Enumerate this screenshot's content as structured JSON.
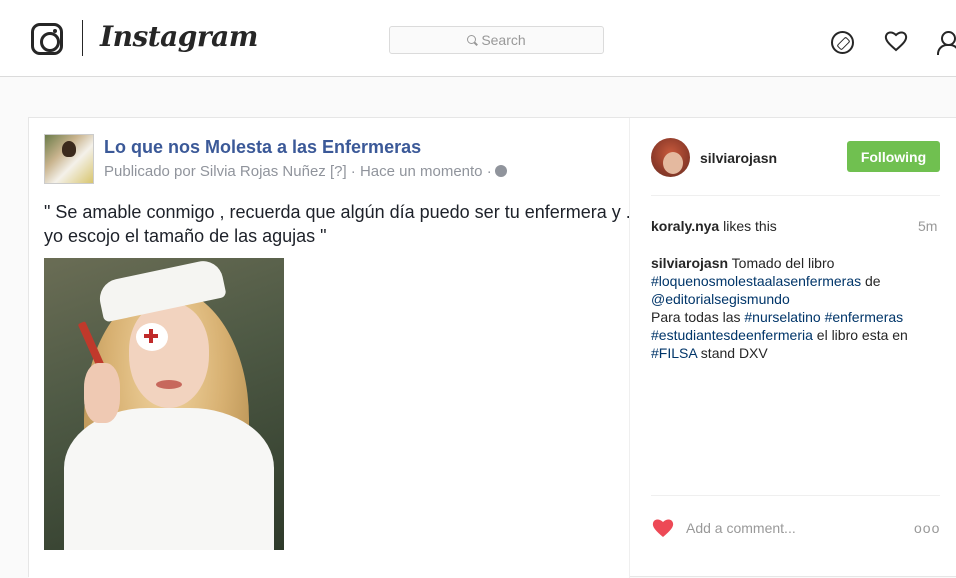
{
  "header": {
    "wordmark": "Instagram",
    "search_placeholder": "Search",
    "icons": [
      "camera-logo-icon",
      "compass-icon",
      "heart-icon",
      "profile-icon"
    ]
  },
  "fb_post": {
    "page_name": "Lo que nos Molesta a las Enfermeras",
    "meta": "Publicado por Silvia Rojas Nuñez [?] · Hace un momento ·",
    "quote_line1": "\" Se amable conmigo , recuerda que algún día puedo ser tu enfermera y .",
    "quote_line2": "yo escojo el tamaño de las agujas \""
  },
  "sidebar": {
    "username": "silviarojasn",
    "follow_label": "Following",
    "follow_color": "#70c050",
    "like_user": "koraly.nya",
    "like_suffix": " likes this",
    "time": "5m",
    "caption": {
      "username": "silviarojasn",
      "text_1": " Tomado del libro",
      "tag_1": "#loquenosmolestaalasenfermeras",
      "text_2": " de",
      "mention_1": "@editorialsegismundo",
      "text_3": "Para todas las ",
      "tag_2": "#nurselatino",
      "tag_3": "#enfermeras",
      "tag_4": "#estudiantesdeenfermeria",
      "text_4": " el libro esta en",
      "tag_5": "#FILSA",
      "text_5": " stand DXV"
    },
    "comment_placeholder": "Add a comment...",
    "more_label": "ooo",
    "like_heart_color": "#ed4956"
  }
}
